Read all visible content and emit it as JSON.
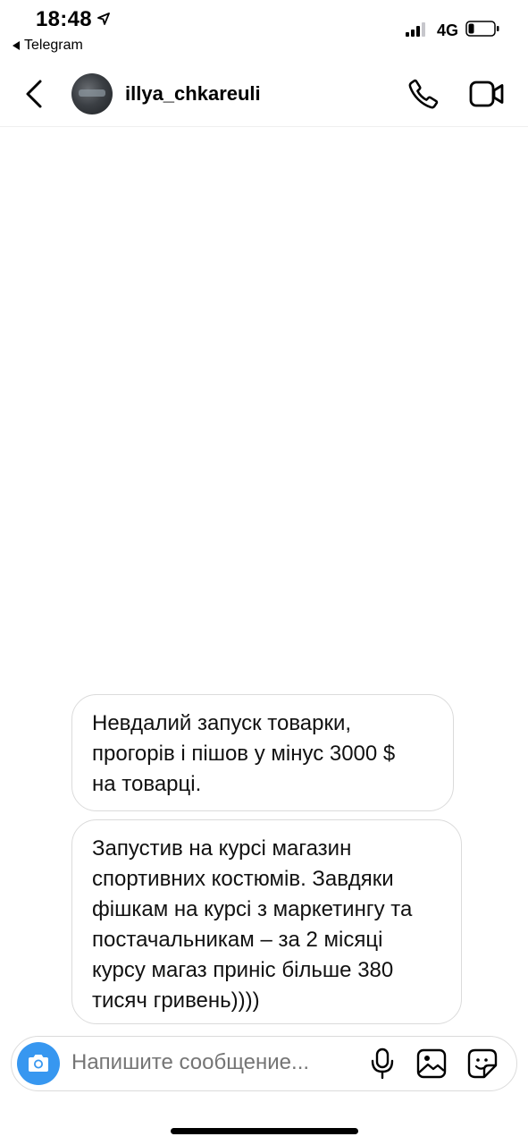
{
  "status_bar": {
    "time": "18:48",
    "back_app": "Telegram",
    "network": "4G",
    "signal_bars_active": 3,
    "signal_bars_total": 4,
    "battery_level": 0.2
  },
  "header": {
    "username": "illya_chkareuli",
    "icons": [
      "back-chevron-icon",
      "avatar",
      "phone-icon",
      "video-camera-icon"
    ]
  },
  "messages": [
    {
      "lines": [
        "Невдалий запуск товарки,",
        "прогорів і пішов у мінус 3000 $",
        "на товарці."
      ]
    },
    {
      "lines": [
        "Запустив на курсі магазин",
        "спортивних костюмів. Завдяки",
        "фішкам на курсі з маркетингу та",
        "постачальникам – за 2 місяці",
        "курсу магаз приніс більше 380",
        "тисяч гривень))))"
      ]
    }
  ],
  "composer": {
    "placeholder": "Напишите сообщение...",
    "accent_color": "#3797f0",
    "icons": [
      "camera-icon",
      "microphone-icon",
      "gallery-icon",
      "sticker-icon"
    ]
  }
}
